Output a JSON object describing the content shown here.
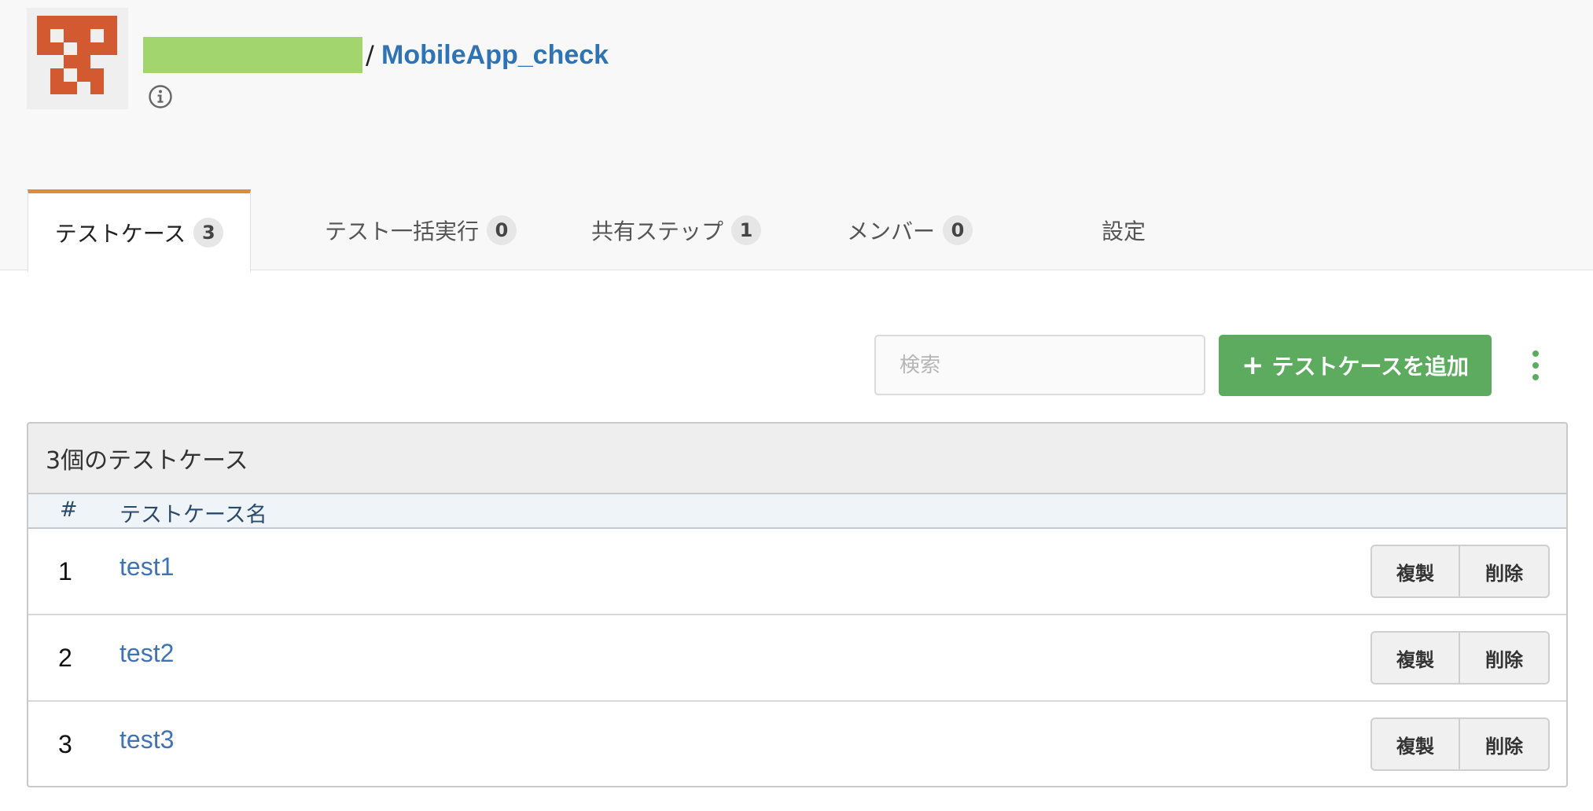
{
  "project": {
    "separator": "/",
    "name": "MobileApp_check"
  },
  "colors": {
    "accent_tab": "#e08a3c",
    "primary_button": "#5cab5e",
    "link": "#2f73b4",
    "avatar_pattern": "#d35a30",
    "redaction": "#a3d56f"
  },
  "tabs": [
    {
      "label": "テストケース",
      "count": "3",
      "active": true
    },
    {
      "label": "テスト一括実行",
      "count": "0",
      "active": false
    },
    {
      "label": "共有ステップ",
      "count": "1",
      "active": false
    },
    {
      "label": "メンバー",
      "count": "0",
      "active": false
    },
    {
      "label": "設定",
      "count": null,
      "active": false
    }
  ],
  "toolbar": {
    "search_placeholder": "検索",
    "search_value": "",
    "add_plus": "+",
    "add_label": "テストケースを追加",
    "more_icon": "kebab-vertical-icon"
  },
  "panel": {
    "heading": "3個のテストケース",
    "columns": {
      "number": "#",
      "name": "テストケース名"
    },
    "rows": [
      {
        "number": "1",
        "name": "test1",
        "copy_label": "複製",
        "delete_label": "削除"
      },
      {
        "number": "2",
        "name": "test2",
        "copy_label": "複製",
        "delete_label": "削除"
      },
      {
        "number": "3",
        "name": "test3",
        "copy_label": "複製",
        "delete_label": "削除"
      }
    ]
  }
}
